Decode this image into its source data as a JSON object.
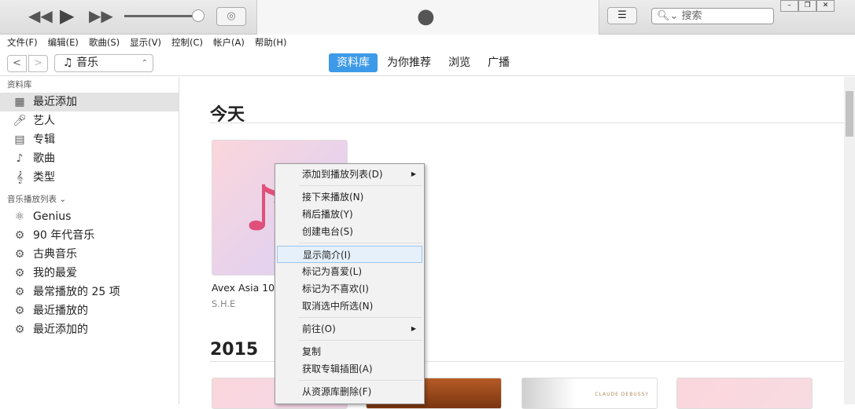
{
  "toolbar": {
    "search_placeholder": "搜索"
  },
  "menu": [
    "文件(F)",
    "编辑(E)",
    "歌曲(S)",
    "显示(V)",
    "控制(C)",
    "帐户(A)",
    "帮助(H)"
  ],
  "nav": {
    "media": "音乐",
    "tabs": [
      "资料库",
      "为你推荐",
      "浏览",
      "广播"
    ]
  },
  "sidebar": {
    "library_header": "资料库",
    "library": [
      "最近添加",
      "艺人",
      "专辑",
      "歌曲",
      "类型"
    ],
    "playlist_header": "音乐播放列表 ⌄",
    "playlists": [
      "Genius",
      "90 年代音乐",
      "古典音乐",
      "我的最爱",
      "最常播放的 25 项",
      "最近播放的",
      "最近添加的"
    ]
  },
  "main": {
    "section1": "今天",
    "album_title": "Avex Asia 10",
    "album_artist": "S.H.E",
    "section2": "2015",
    "debussy_label": "CLAUDE DEBUSSY"
  },
  "context_menu": [
    [
      "添加到播放列表(D)",
      "添加到播放列表(D)"
    ],
    "接下来播放(N)",
    "稍后播放(Y)",
    "创建电台(S)",
    "显示简介(I)",
    "标记为喜爱(L)",
    "标记为不喜欢(I)",
    "取消选中所选(N)",
    "前往(O)",
    "复制",
    "获取专辑插图(A)",
    "从资源库删除(F)"
  ]
}
